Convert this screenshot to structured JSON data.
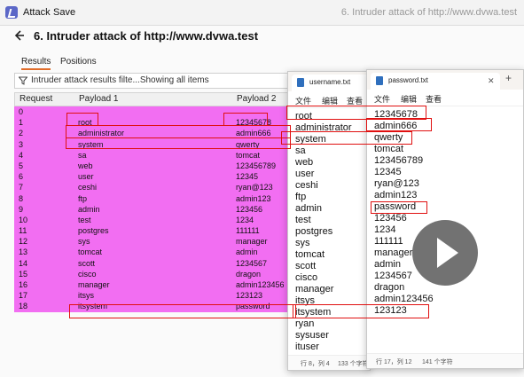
{
  "menubar": {
    "items": [
      "Attack",
      "Save"
    ],
    "window_title": "6. Intruder attack of http://www.dvwa.test"
  },
  "header": {
    "title": "6. Intruder attack of http://www.dvwa.test"
  },
  "tabs": [
    {
      "label": "Results",
      "active": true
    },
    {
      "label": "Positions",
      "active": false
    }
  ],
  "filter": {
    "text": "Intruder attack results filte...Showing all items"
  },
  "table": {
    "columns": [
      "Request",
      "Payload 1",
      "Payload 2"
    ],
    "rows": [
      [
        "0",
        "",
        ""
      ],
      [
        "1",
        "root",
        "12345678"
      ],
      [
        "2",
        "administrator",
        "admin666"
      ],
      [
        "3",
        "system",
        "qwerty"
      ],
      [
        "4",
        "sa",
        "tomcat"
      ],
      [
        "5",
        "web",
        "123456789"
      ],
      [
        "6",
        "user",
        "12345"
      ],
      [
        "7",
        "ceshi",
        "ryan@123"
      ],
      [
        "8",
        "ftp",
        "admin123"
      ],
      [
        "9",
        "admin",
        "123456"
      ],
      [
        "10",
        "test",
        "1234"
      ],
      [
        "11",
        "postgres",
        "111111"
      ],
      [
        "12",
        "sys",
        "manager"
      ],
      [
        "13",
        "tomcat",
        "admin"
      ],
      [
        "14",
        "scott",
        "1234567"
      ],
      [
        "15",
        "cisco",
        "dragon"
      ],
      [
        "16",
        "manager",
        "admin123456"
      ],
      [
        "17",
        "itsys",
        "123123"
      ],
      [
        "18",
        "itsystem",
        "password"
      ]
    ]
  },
  "notepad_user": {
    "filename": "username.txt",
    "menu": [
      "文件",
      "编辑",
      "查看"
    ],
    "lines": [
      "root",
      "administrator",
      "system",
      "sa",
      "web",
      "user",
      "ceshi",
      "ftp",
      "admin",
      "test",
      "postgres",
      "sys",
      "tomcat",
      "scott",
      "cisco",
      "manager",
      "itsys",
      "itsystem",
      "ryan",
      "sysuser",
      "ituser"
    ],
    "status_pos": "行 8，列 4",
    "status_chars": "133 个字符"
  },
  "notepad_pass": {
    "filename": "password.txt",
    "menu": [
      "文件",
      "编辑",
      "查看"
    ],
    "lines": [
      "12345678",
      "admin666",
      "qwerty",
      "tomcat",
      "123456789",
      "12345",
      "ryan@123",
      "admin123",
      "password",
      "123456",
      "1234",
      "111111",
      "manager",
      "admin",
      "1234567",
      "dragon",
      "admin123456",
      "123123"
    ],
    "status_pos": "行 17，列 12",
    "status_chars": "141 个字符"
  },
  "colors": {
    "highlight": "#f26ef2",
    "annotation": "#e01010",
    "tab_accent": "#e06c2a"
  },
  "icons": [
    "burp-logo-icon",
    "back-arrow-icon",
    "filter-icon",
    "notepad-file-icon",
    "close-icon",
    "plus-icon",
    "play-icon"
  ]
}
